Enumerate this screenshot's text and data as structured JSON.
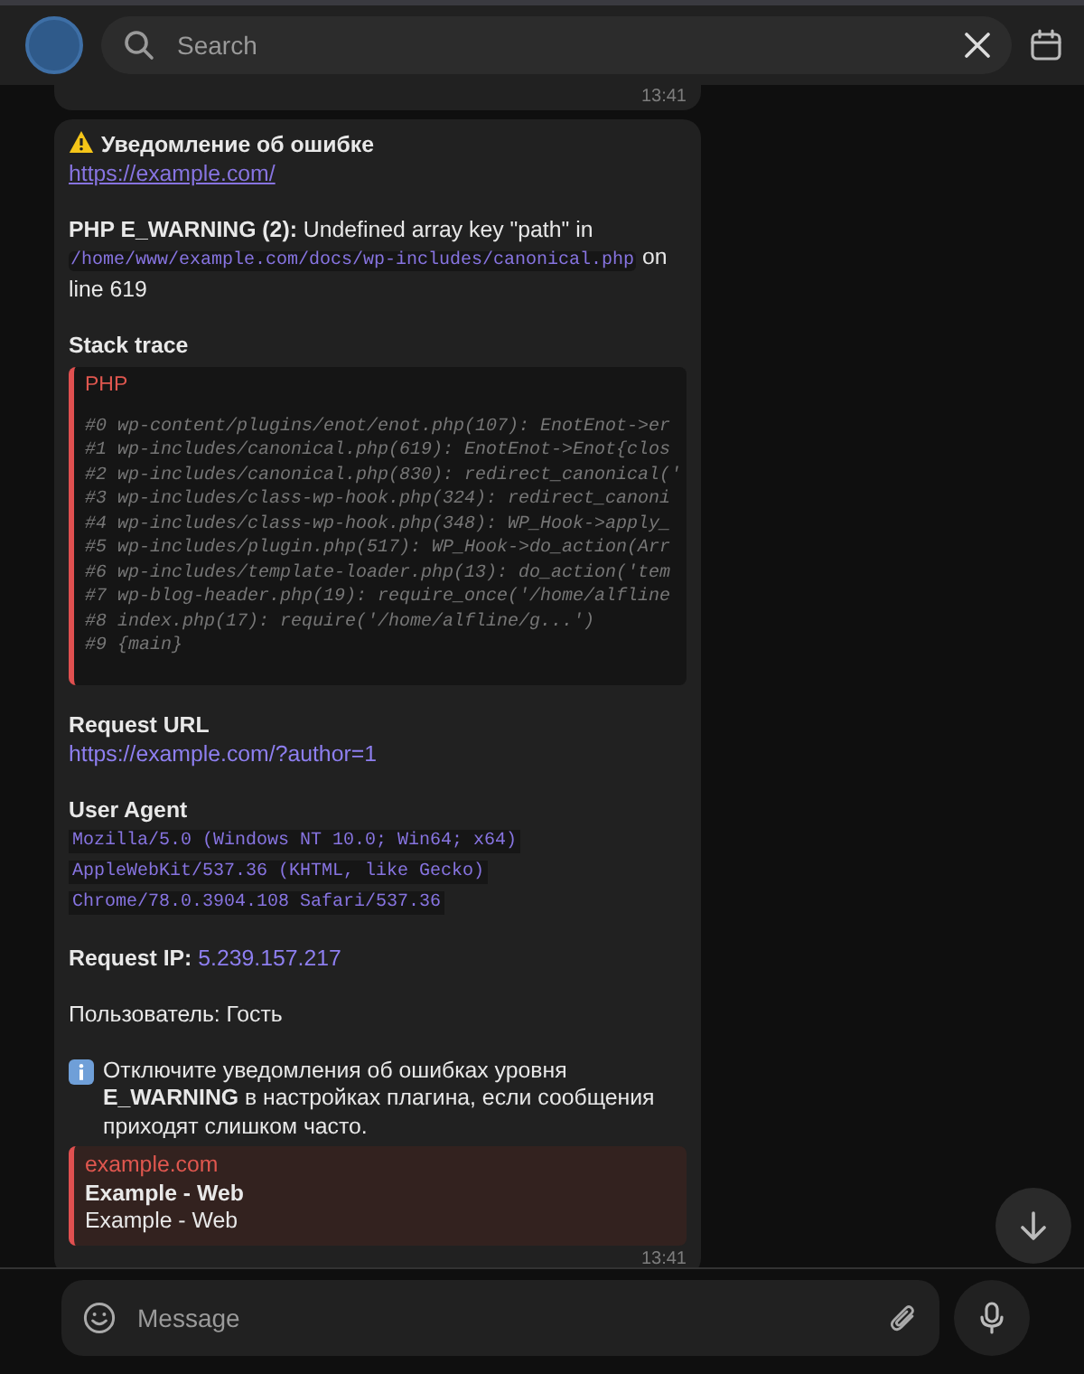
{
  "header": {
    "search": {
      "placeholder": "Search"
    }
  },
  "previous_message": {
    "time": "13:41"
  },
  "message": {
    "title": "Уведомление об ошибке",
    "link": "https://example.com/",
    "error": {
      "lead": "**PHP E_WARNING (2):** Undefined array key \"path\" in",
      "file": "/home/www/example.com/docs/wp-includes/canonical.php",
      "trail": "on line 619"
    },
    "stack_heading": "Stack trace",
    "stack": {
      "language": "PHP",
      "lines": [
        "#0 wp-content/plugins/enot/enot.php(107): EnotEnot->er",
        "#1 wp-includes/canonical.php(619): EnotEnot->Enot{clos",
        "#2 wp-includes/canonical.php(830): redirect_canonical('",
        "#3 wp-includes/class-wp-hook.php(324): redirect_canoni",
        "#4 wp-includes/class-wp-hook.php(348): WP_Hook->apply_",
        "#5 wp-includes/plugin.php(517): WP_Hook->do_action(Arr",
        "#6 wp-includes/template-loader.php(13): do_action('tem",
        "#7 wp-blog-header.php(19): require_once('/home/alfline",
        "#8 index.php(17): require('/home/alfline/g...')",
        "#9 {main}"
      ]
    },
    "request_url_heading": "Request URL",
    "request_url": "https://example.com/?author=1",
    "user_agent_heading": "User Agent",
    "user_agent": [
      "Mozilla/5.0 (Windows NT 10.0; Win64; x64)",
      "AppleWebKit/537.36 (KHTML, like Gecko)",
      "Chrome/78.0.3904.108 Safari/537.36"
    ],
    "request_ip_label": "Request IP:",
    "request_ip": "5.239.157.217",
    "user_line": "Пользователь: Гость",
    "notice": "Отключите уведомления об ошибках уровня **E_WARNING** в настройках плагина, если сообщения приходят слишком часто.",
    "preview": {
      "site": "example.com",
      "title": "Example - Web",
      "description": "Example - Web"
    },
    "time": "13:41"
  },
  "composer": {
    "placeholder": "Message"
  }
}
